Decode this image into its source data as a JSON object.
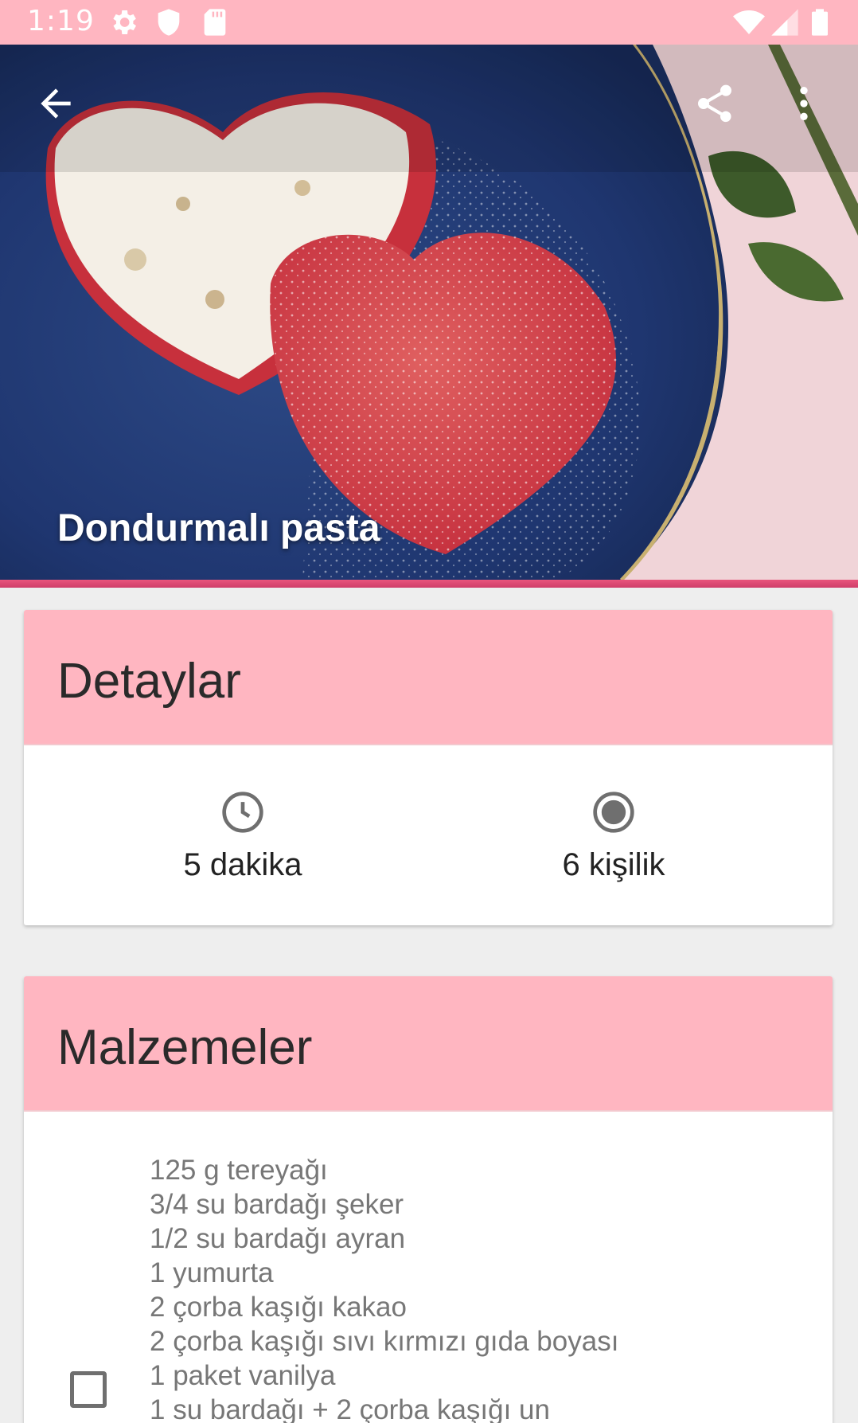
{
  "status_bar": {
    "time": "1:19",
    "icons": [
      "settings-gear-icon",
      "shield-icon",
      "sd-card-icon",
      "wifi-icon",
      "signal-icon",
      "battery-icon"
    ]
  },
  "toolbar": {
    "back_icon": "back-arrow-icon",
    "share_icon": "share-icon",
    "more_icon": "more-vert-icon"
  },
  "recipe": {
    "title": "Dondurmalı pasta"
  },
  "details": {
    "header": "Detaylar",
    "time_icon": "clock-icon",
    "time": "5 dakika",
    "servings_icon": "radio-button-icon",
    "servings": "6 kişilik"
  },
  "ingredients": {
    "header": "Malzemeler",
    "items": [
      "125 g tereyağı",
      "3/4 su bardağı şeker",
      "1/2 su bardağı ayran",
      "1 yumurta",
      "2 çorba kaşığı kakao",
      "2 çorba kaşığı sıvı kırmızı gıda boyası",
      "1 paket vanilya",
      "1 su bardağı + 2 çorba kaşığı un"
    ]
  },
  "colors": {
    "accent": "#ffb6c1",
    "hero_underline": "#e8547c",
    "background": "#eeeeee"
  }
}
